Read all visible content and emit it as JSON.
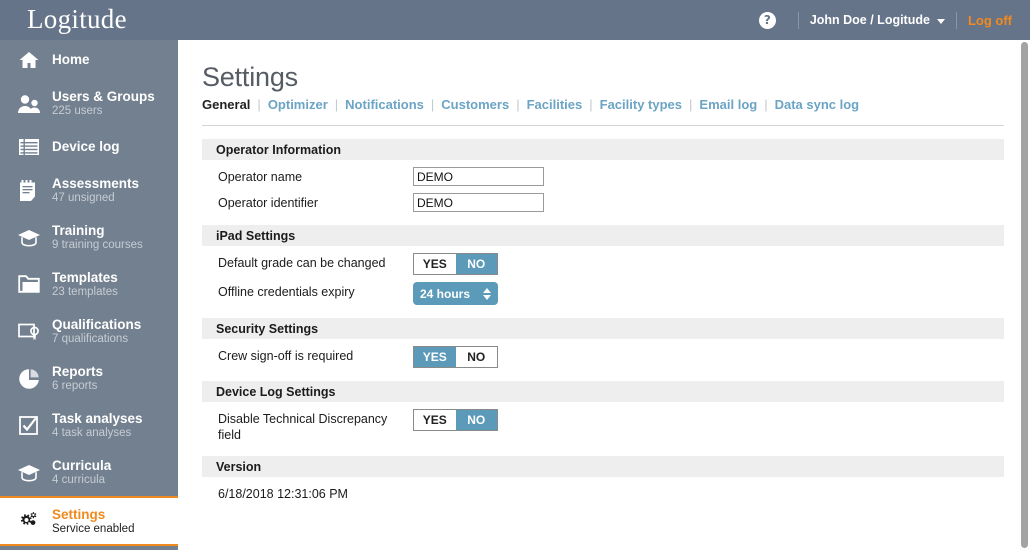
{
  "topbar": {
    "logo": "Logitude",
    "help_icon": "question-mark-icon",
    "user": "John Doe / Logitude",
    "logoff": "Log off"
  },
  "sidebar": {
    "items": [
      {
        "icon": "home-icon",
        "title": "Home",
        "sub": ""
      },
      {
        "icon": "users-icon",
        "title": "Users & Groups",
        "sub": "225 users"
      },
      {
        "icon": "device-log-icon",
        "title": "Device log",
        "sub": ""
      },
      {
        "icon": "assessments-icon",
        "title": "Assessments",
        "sub": "47 unsigned"
      },
      {
        "icon": "training-icon",
        "title": "Training",
        "sub": "9 training courses"
      },
      {
        "icon": "templates-icon",
        "title": "Templates",
        "sub": "23 templates"
      },
      {
        "icon": "qualifications-icon",
        "title": "Qualifications",
        "sub": "7 qualifications"
      },
      {
        "icon": "reports-icon",
        "title": "Reports",
        "sub": "6 reports"
      },
      {
        "icon": "task-analyses-icon",
        "title": "Task analyses",
        "sub": "4 task analyses"
      },
      {
        "icon": "curricula-icon",
        "title": "Curricula",
        "sub": "4 curricula"
      },
      {
        "icon": "settings-icon",
        "title": "Settings",
        "sub": "Service enabled"
      }
    ]
  },
  "main": {
    "title": "Settings",
    "tabs": [
      {
        "label": "General",
        "active": true
      },
      {
        "label": "Optimizer",
        "active": false
      },
      {
        "label": "Notifications",
        "active": false
      },
      {
        "label": "Customers",
        "active": false
      },
      {
        "label": "Facilities",
        "active": false
      },
      {
        "label": "Facility types",
        "active": false
      },
      {
        "label": "Email log",
        "active": false
      },
      {
        "label": "Data sync log",
        "active": false
      }
    ],
    "tab_separator": "|",
    "sections": {
      "operator": {
        "heading": "Operator Information",
        "name_label": "Operator name",
        "name_value": "DEMO",
        "identifier_label": "Operator identifier",
        "identifier_value": "DEMO"
      },
      "ipad": {
        "heading": "iPad Settings",
        "grade_label": "Default grade can be changed",
        "grade_yes": "YES",
        "grade_no": "NO",
        "grade_selected": "NO",
        "expiry_label": "Offline credentials expiry",
        "expiry_value": "24 hours"
      },
      "security": {
        "heading": "Security Settings",
        "crew_label": "Crew sign-off is required",
        "crew_yes": "YES",
        "crew_no": "NO",
        "crew_selected": "YES"
      },
      "device_log": {
        "heading": "Device Log Settings",
        "discrepancy_label": "Disable Technical Discrepancy field",
        "discrepancy_yes": "YES",
        "discrepancy_no": "NO",
        "discrepancy_selected": "NO"
      },
      "version": {
        "heading": "Version",
        "value": "6/18/2018 12:31:06 PM"
      }
    }
  },
  "colors": {
    "topbar": "#66748a",
    "sidebar": "#73808f",
    "accent_orange": "#f08a1e",
    "accent_teal": "#5b9ab8",
    "tab_link": "#6ba4c4",
    "section_head": "#eeeeee"
  }
}
